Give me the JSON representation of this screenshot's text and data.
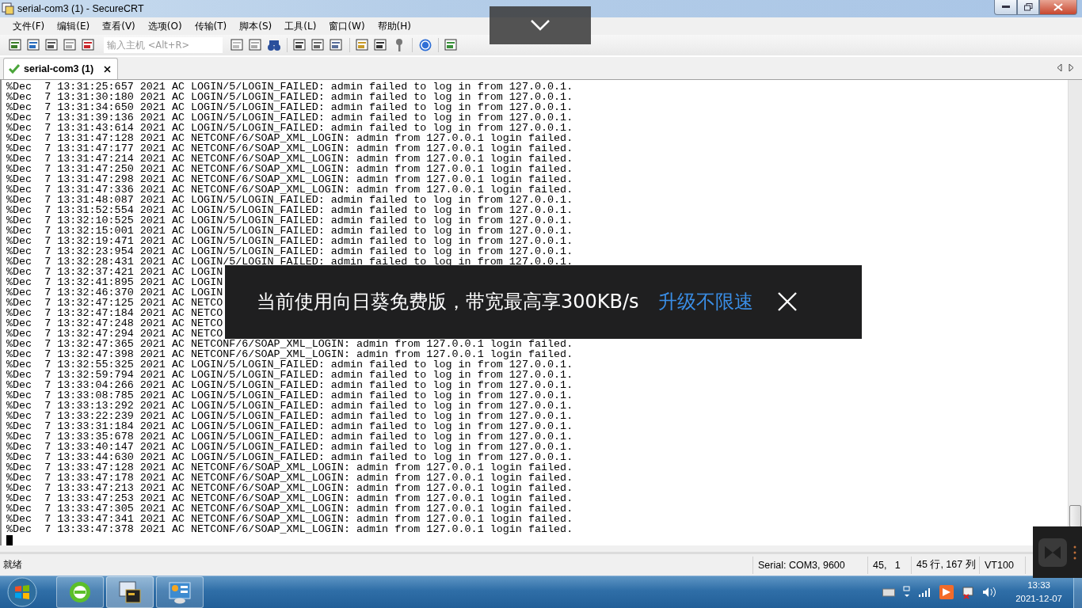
{
  "window": {
    "title": "serial-com3 (1) - SecureCRT"
  },
  "menu": [
    "文件(F)",
    "编辑(E)",
    "查看(V)",
    "选项(O)",
    "传输(T)",
    "脚本(S)",
    "工具(L)",
    "窗口(W)",
    "帮助(H)"
  ],
  "toolbar": {
    "host_field": {
      "placeholder": "输入主机 <Alt+R>"
    }
  },
  "tabs": [
    {
      "label": "serial-com3 (1)",
      "selected": true,
      "connected": true
    }
  ],
  "terminal": {
    "lines": [
      "%Dec  7 13:31:25:657 2021 AC LOGIN/5/LOGIN_FAILED: admin failed to log in from 127.0.0.1.",
      "%Dec  7 13:31:30:180 2021 AC LOGIN/5/LOGIN_FAILED: admin failed to log in from 127.0.0.1.",
      "%Dec  7 13:31:34:650 2021 AC LOGIN/5/LOGIN_FAILED: admin failed to log in from 127.0.0.1.",
      "%Dec  7 13:31:39:136 2021 AC LOGIN/5/LOGIN_FAILED: admin failed to log in from 127.0.0.1.",
      "%Dec  7 13:31:43:614 2021 AC LOGIN/5/LOGIN_FAILED: admin failed to log in from 127.0.0.1.",
      "%Dec  7 13:31:47:128 2021 AC NETCONF/6/SOAP_XML_LOGIN: admin from 127.0.0.1 login failed.",
      "%Dec  7 13:31:47:177 2021 AC NETCONF/6/SOAP_XML_LOGIN: admin from 127.0.0.1 login failed.",
      "%Dec  7 13:31:47:214 2021 AC NETCONF/6/SOAP_XML_LOGIN: admin from 127.0.0.1 login failed.",
      "%Dec  7 13:31:47:250 2021 AC NETCONF/6/SOAP_XML_LOGIN: admin from 127.0.0.1 login failed.",
      "%Dec  7 13:31:47:298 2021 AC NETCONF/6/SOAP_XML_LOGIN: admin from 127.0.0.1 login failed.",
      "%Dec  7 13:31:47:336 2021 AC NETCONF/6/SOAP_XML_LOGIN: admin from 127.0.0.1 login failed.",
      "%Dec  7 13:31:48:087 2021 AC LOGIN/5/LOGIN_FAILED: admin failed to log in from 127.0.0.1.",
      "%Dec  7 13:31:52:554 2021 AC LOGIN/5/LOGIN_FAILED: admin failed to log in from 127.0.0.1.",
      "%Dec  7 13:32:10:525 2021 AC LOGIN/5/LOGIN_FAILED: admin failed to log in from 127.0.0.1.",
      "%Dec  7 13:32:15:001 2021 AC LOGIN/5/LOGIN_FAILED: admin failed to log in from 127.0.0.1.",
      "%Dec  7 13:32:19:471 2021 AC LOGIN/5/LOGIN_FAILED: admin failed to log in from 127.0.0.1.",
      "%Dec  7 13:32:23:954 2021 AC LOGIN/5/LOGIN_FAILED: admin failed to log in from 127.0.0.1.",
      "%Dec  7 13:32:28:431 2021 AC LOGIN/5/LOGIN_FAILED: admin failed to log in from 127.0.0.1.",
      "%Dec  7 13:32:37:421 2021 AC LOGIN",
      "%Dec  7 13:32:41:895 2021 AC LOGIN",
      "%Dec  7 13:32:46:370 2021 AC LOGIN",
      "%Dec  7 13:32:47:125 2021 AC NETCO",
      "%Dec  7 13:32:47:184 2021 AC NETCO",
      "%Dec  7 13:32:47:248 2021 AC NETCO",
      "%Dec  7 13:32:47:294 2021 AC NETCO",
      "%Dec  7 13:32:47:365 2021 AC NETCONF/6/SOAP_XML_LOGIN: admin from 127.0.0.1 login failed.",
      "%Dec  7 13:32:47:398 2021 AC NETCONF/6/SOAP_XML_LOGIN: admin from 127.0.0.1 login failed.",
      "%Dec  7 13:32:55:325 2021 AC LOGIN/5/LOGIN_FAILED: admin failed to log in from 127.0.0.1.",
      "%Dec  7 13:32:59:794 2021 AC LOGIN/5/LOGIN_FAILED: admin failed to log in from 127.0.0.1.",
      "%Dec  7 13:33:04:266 2021 AC LOGIN/5/LOGIN_FAILED: admin failed to log in from 127.0.0.1.",
      "%Dec  7 13:33:08:785 2021 AC LOGIN/5/LOGIN_FAILED: admin failed to log in from 127.0.0.1.",
      "%Dec  7 13:33:13:292 2021 AC LOGIN/5/LOGIN_FAILED: admin failed to log in from 127.0.0.1.",
      "%Dec  7 13:33:22:239 2021 AC LOGIN/5/LOGIN_FAILED: admin failed to log in from 127.0.0.1.",
      "%Dec  7 13:33:31:184 2021 AC LOGIN/5/LOGIN_FAILED: admin failed to log in from 127.0.0.1.",
      "%Dec  7 13:33:35:678 2021 AC LOGIN/5/LOGIN_FAILED: admin failed to log in from 127.0.0.1.",
      "%Dec  7 13:33:40:147 2021 AC LOGIN/5/LOGIN_FAILED: admin failed to log in from 127.0.0.1.",
      "%Dec  7 13:33:44:630 2021 AC LOGIN/5/LOGIN_FAILED: admin failed to log in from 127.0.0.1.",
      "%Dec  7 13:33:47:128 2021 AC NETCONF/6/SOAP_XML_LOGIN: admin from 127.0.0.1 login failed.",
      "%Dec  7 13:33:47:178 2021 AC NETCONF/6/SOAP_XML_LOGIN: admin from 127.0.0.1 login failed.",
      "%Dec  7 13:33:47:213 2021 AC NETCONF/6/SOAP_XML_LOGIN: admin from 127.0.0.1 login failed.",
      "%Dec  7 13:33:47:253 2021 AC NETCONF/6/SOAP_XML_LOGIN: admin from 127.0.0.1 login failed.",
      "%Dec  7 13:33:47:305 2021 AC NETCONF/6/SOAP_XML_LOGIN: admin from 127.0.0.1 login failed.",
      "%Dec  7 13:33:47:341 2021 AC NETCONF/6/SOAP_XML_LOGIN: admin from 127.0.0.1 login failed.",
      "%Dec  7 13:33:47:378 2021 AC NETCONF/6/SOAP_XML_LOGIN: admin from 127.0.0.1 login failed."
    ],
    "cursor": true
  },
  "banner": {
    "message": "当前使用向日葵免费版，带宽最高享300KB/s",
    "link": "升级不限速"
  },
  "status_bar": {
    "state": "就绪",
    "connection": "Serial: COM3, 9600",
    "position": "45,   1",
    "size": "45 行, 167 列",
    "emulation": "VT100"
  },
  "taskbar": {
    "time": "13:33",
    "date": "2021-12-07"
  }
}
